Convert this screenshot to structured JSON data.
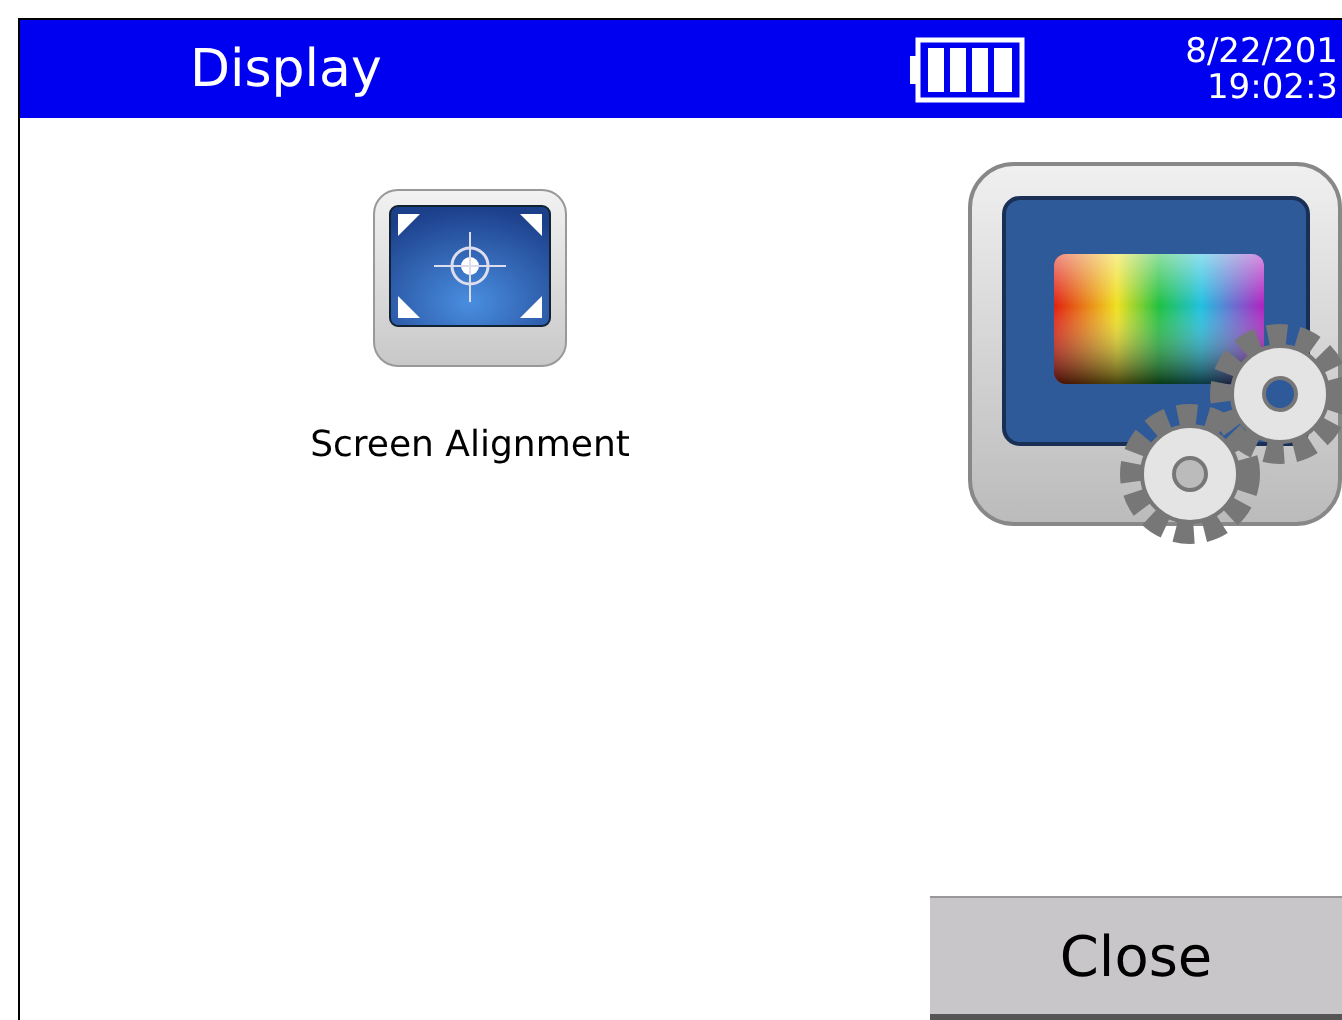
{
  "header": {
    "title": "Display",
    "date": "8/22/201",
    "time": "19:02:3"
  },
  "items": [
    {
      "kind": "alignment",
      "label": "Screen Alignment"
    },
    {
      "kind": "color-settings"
    }
  ],
  "buttons": [
    {
      "label": "Close"
    }
  ]
}
